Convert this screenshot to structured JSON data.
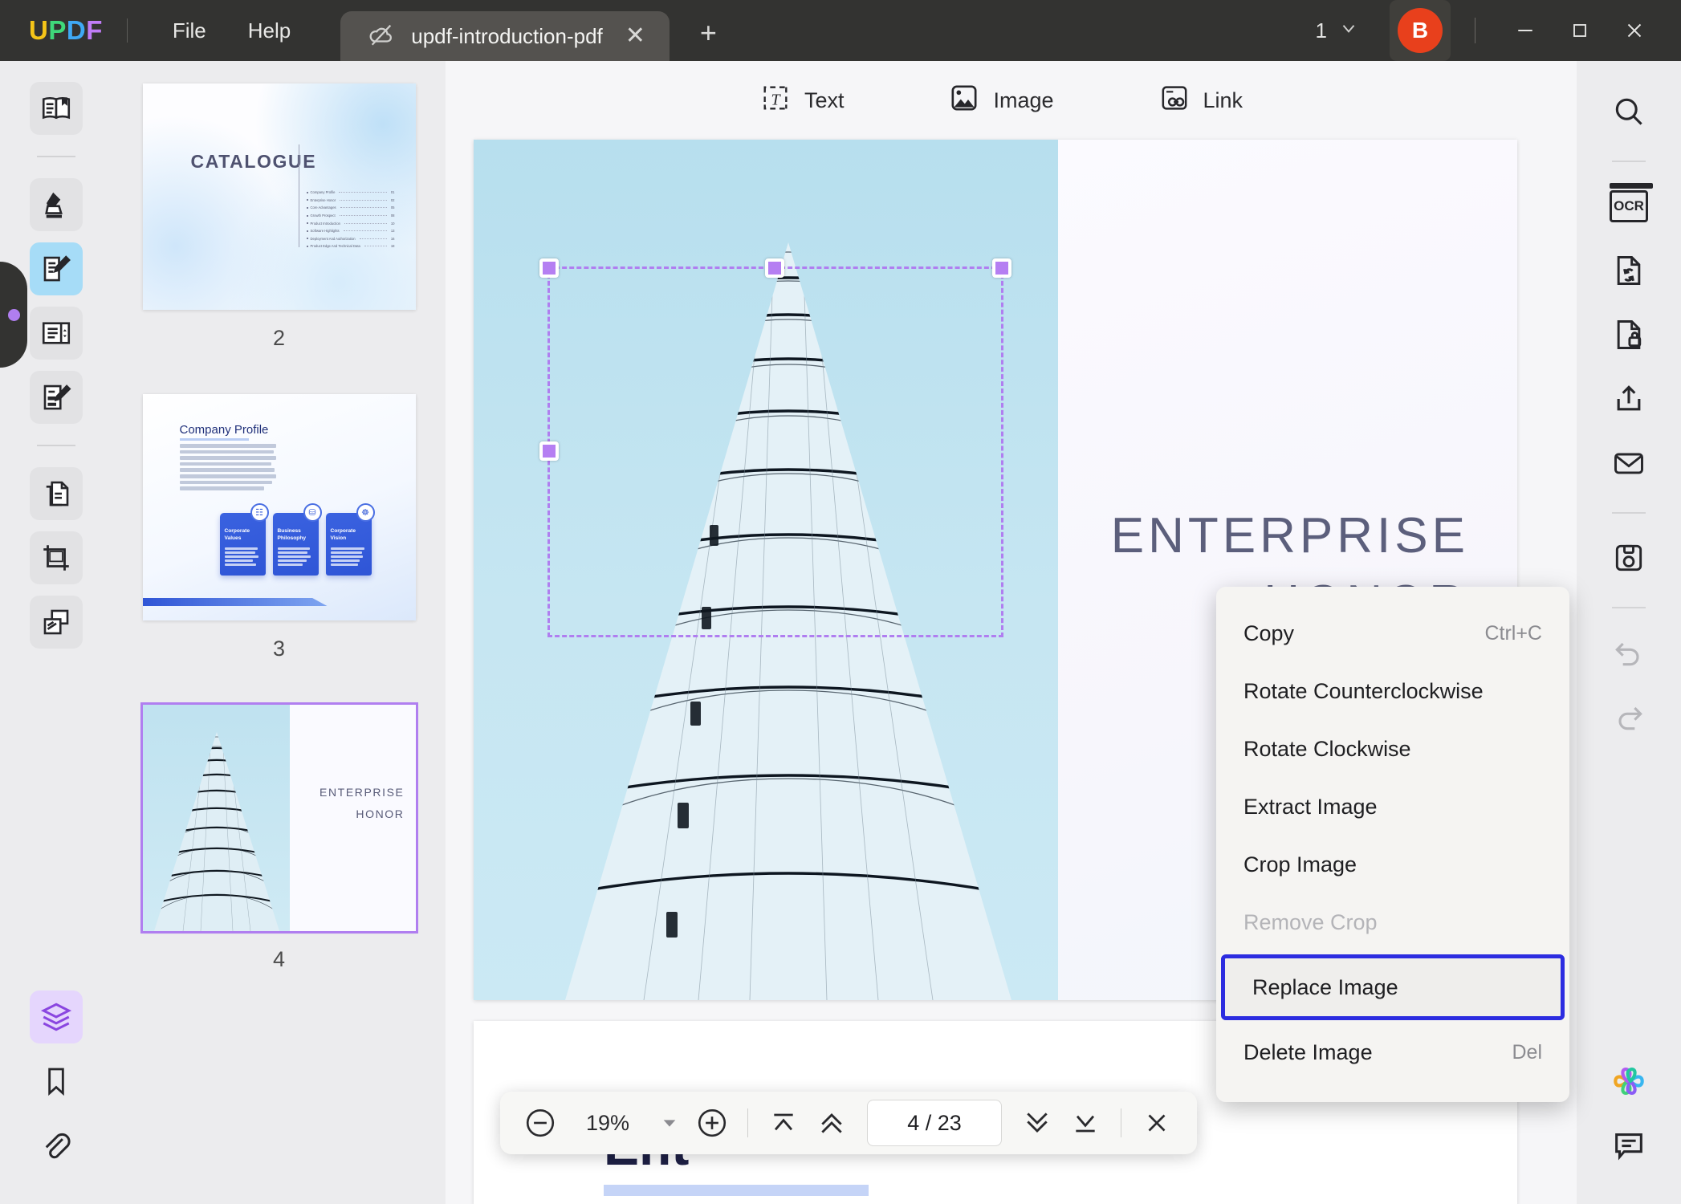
{
  "app": {
    "name": "UPDF",
    "logo_letters": [
      "U",
      "P",
      "D",
      "F"
    ],
    "logo_colors": [
      "#f5c518",
      "#3fd87a",
      "#3fa9f5",
      "#c07cf7"
    ]
  },
  "titlebar": {
    "menus": [
      {
        "label": "File",
        "name": "menu-file"
      },
      {
        "label": "Help",
        "name": "menu-help"
      }
    ],
    "tab": {
      "title": "updf-introduction-pdf",
      "icon": "cloud-off-icon",
      "close": "✕"
    },
    "new_tab": "+",
    "window_count": "1",
    "avatar_initial": "B",
    "avatar_color": "#e8401c",
    "controls": {
      "minimize": "minimize-icon",
      "maximize": "maximize-icon",
      "close": "close-icon"
    }
  },
  "left_rail": {
    "items": [
      {
        "name": "sidebar-item-reader",
        "icon": "book-bookmark-icon",
        "state": "normal"
      },
      {
        "name": "sidebar-item-annotate-highlighter",
        "icon": "highlighter-icon",
        "state": "normal"
      },
      {
        "name": "sidebar-item-edit-pdf",
        "icon": "document-pencil-icon",
        "state": "active"
      },
      {
        "name": "sidebar-item-page-organize",
        "icon": "page-sort-icon",
        "state": "normal"
      },
      {
        "name": "sidebar-item-fill-sign",
        "icon": "form-pen-icon",
        "state": "normal"
      },
      {
        "name": "sidebar-item-organize-pages",
        "icon": "pages-copy-icon",
        "state": "normal"
      },
      {
        "name": "sidebar-item-crop",
        "icon": "crop-icon",
        "state": "normal"
      },
      {
        "name": "sidebar-item-batch",
        "icon": "layers-stack-icon",
        "state": "normal"
      }
    ],
    "bottom_items": [
      {
        "name": "sidebar-item-layers",
        "icon": "layers-icon",
        "state": "active-purple"
      },
      {
        "name": "sidebar-item-bookmarks",
        "icon": "bookmark-icon",
        "state": "normal"
      },
      {
        "name": "sidebar-item-attachments",
        "icon": "paperclip-icon",
        "state": "normal"
      }
    ],
    "collapse_handle": "collapse-panel-handle"
  },
  "thumbnails": [
    {
      "page": "2",
      "selected": false,
      "kind": "catalogue",
      "title": "CATALOGUE",
      "toc": [
        {
          "label": "Company Profile",
          "page": "01"
        },
        {
          "label": "Enterprise Honor",
          "page": "02"
        },
        {
          "label": "Core Advantages",
          "page": "05"
        },
        {
          "label": "Growth Prospect",
          "page": "08"
        },
        {
          "label": "Product Introduction",
          "page": "10"
        },
        {
          "label": "Software Highlights",
          "page": "13"
        },
        {
          "label": "Deployment And Authorization",
          "page": "16"
        },
        {
          "label": "Product Edge And Technical Data",
          "page": "18"
        }
      ]
    },
    {
      "page": "3",
      "selected": false,
      "kind": "profile",
      "title": "Company Profile",
      "cards": [
        {
          "title": "Corporate Values",
          "badge": "☷"
        },
        {
          "title": "Business Philosophy",
          "badge": "⛁"
        },
        {
          "title": "Corporate Vision",
          "badge": "☸"
        }
      ]
    },
    {
      "page": "4",
      "selected": true,
      "kind": "honor",
      "title_lines": [
        "ENTERPRISE",
        "HONOR"
      ]
    }
  ],
  "edit_toolbar": [
    {
      "label": "Text",
      "name": "edit-tool-text",
      "icon": "text-box-icon"
    },
    {
      "label": "Image",
      "name": "edit-tool-image",
      "icon": "image-icon"
    },
    {
      "label": "Link",
      "name": "edit-tool-link",
      "icon": "link-icon"
    }
  ],
  "document": {
    "current_page": {
      "title_lines": [
        "ENTERPRISE",
        "HONOR"
      ],
      "image_alt": "skyscraper-photo"
    },
    "next_page_peek": {
      "text": "Ent"
    }
  },
  "context_menu": {
    "items": [
      {
        "label": "Copy",
        "shortcut": "Ctrl+C",
        "state": "normal",
        "name": "ctx-copy"
      },
      {
        "label": "Rotate Counterclockwise",
        "shortcut": "",
        "state": "normal",
        "name": "ctx-rotate-ccw"
      },
      {
        "label": "Rotate Clockwise",
        "shortcut": "",
        "state": "normal",
        "name": "ctx-rotate-cw"
      },
      {
        "label": "Extract Image",
        "shortcut": "",
        "state": "normal",
        "name": "ctx-extract-image"
      },
      {
        "label": "Crop Image",
        "shortcut": "",
        "state": "normal",
        "name": "ctx-crop-image"
      },
      {
        "label": "Remove Crop",
        "shortcut": "",
        "state": "disabled",
        "name": "ctx-remove-crop"
      },
      {
        "label": "Replace Image",
        "shortcut": "",
        "state": "highlight",
        "name": "ctx-replace-image"
      },
      {
        "label": "Delete Image",
        "shortcut": "Del",
        "state": "normal",
        "name": "ctx-delete-image"
      }
    ],
    "highlight_color": "#2c2ce0"
  },
  "bottom_toolbar": {
    "zoom_out": "zoom-out-icon",
    "zoom_value": "19%",
    "zoom_dropdown": "chevron-down-icon",
    "zoom_in": "zoom-in-icon",
    "first_page": "first-page-icon",
    "prev_page": "prev-page-icon",
    "page_indicator": "4 / 23",
    "current_page": "4",
    "total_pages": "23",
    "next_page": "next-page-icon",
    "last_page": "last-page-icon",
    "close": "close-icon"
  },
  "right_rail": {
    "items": [
      {
        "name": "tool-search",
        "icon": "search-icon"
      },
      {
        "name": "tool-ocr",
        "icon": "ocr-icon",
        "label": "OCR"
      },
      {
        "name": "tool-convert",
        "icon": "convert-file-icon"
      },
      {
        "name": "tool-protect",
        "icon": "file-lock-icon"
      },
      {
        "name": "tool-share",
        "icon": "share-upload-icon"
      },
      {
        "name": "tool-email",
        "icon": "email-icon"
      },
      {
        "name": "tool-save",
        "icon": "floppy-save-icon"
      },
      {
        "name": "tool-undo",
        "icon": "undo-icon",
        "state": "disabled"
      },
      {
        "name": "tool-redo",
        "icon": "redo-icon",
        "state": "disabled"
      }
    ],
    "bottom_items": [
      {
        "name": "tool-ai-assistant",
        "icon": "ai-flower-icon"
      },
      {
        "name": "tool-comments",
        "icon": "comment-icon"
      }
    ]
  },
  "colors": {
    "titlebar_bg": "#333331",
    "rail_bg": "#ececee",
    "canvas_bg": "#f6f6f8",
    "accent_purple": "#b07ef0",
    "accent_blue": "#a6dcf7",
    "selection_purple": "#b57ff2"
  }
}
